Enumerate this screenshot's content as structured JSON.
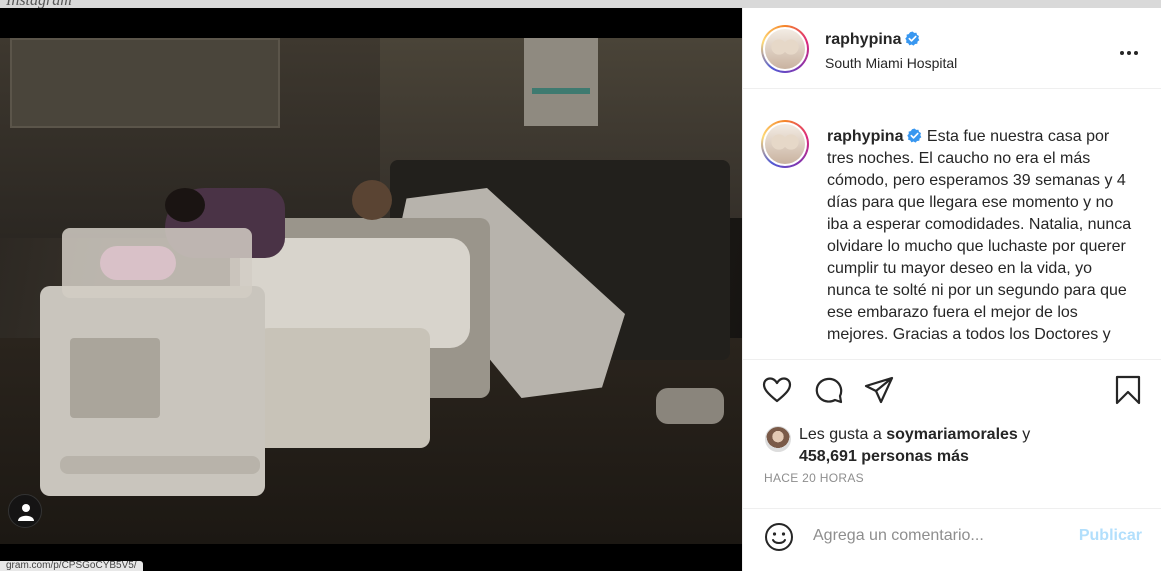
{
  "post": {
    "username": "raphypina",
    "verified": true,
    "location": "South Miami Hospital",
    "caption": "Esta fue nuestra casa por tres noches. El caucho no era el más cómodo, pero esperamos 39 semanas y 4 días para que llegara ese momento y no iba a esperar comodidades. Natalia, nunca olvidare lo mucho que luchaste por querer cumplir tu mayor deseo en la vida, yo nunca te solté ni por un segundo para que ese embarazo fuera el mejor de los mejores. Gracias a todos los Doctores y"
  },
  "likes": {
    "prefix": "Les gusta a",
    "liker": "soymariamorales",
    "suffix": "y",
    "others": "458,691 personas más"
  },
  "timestamp": "HACE 20 HORAS",
  "comment": {
    "placeholder": "Agrega un comentario...",
    "publish_label": "Publicar"
  },
  "status_url": "gram.com/p/CPSGoCYB5V5/",
  "colors": {
    "verified": "#3897f0",
    "publish_disabled": "#b2dffc",
    "secondary_text": "#8e8e8e"
  },
  "icons": {
    "like": "heart-icon",
    "comment": "comment-icon",
    "share": "paper-plane-icon",
    "save": "bookmark-icon",
    "more": "more-options-icon",
    "emoji": "emoji-icon",
    "photo_tag": "user-tag-icon"
  }
}
